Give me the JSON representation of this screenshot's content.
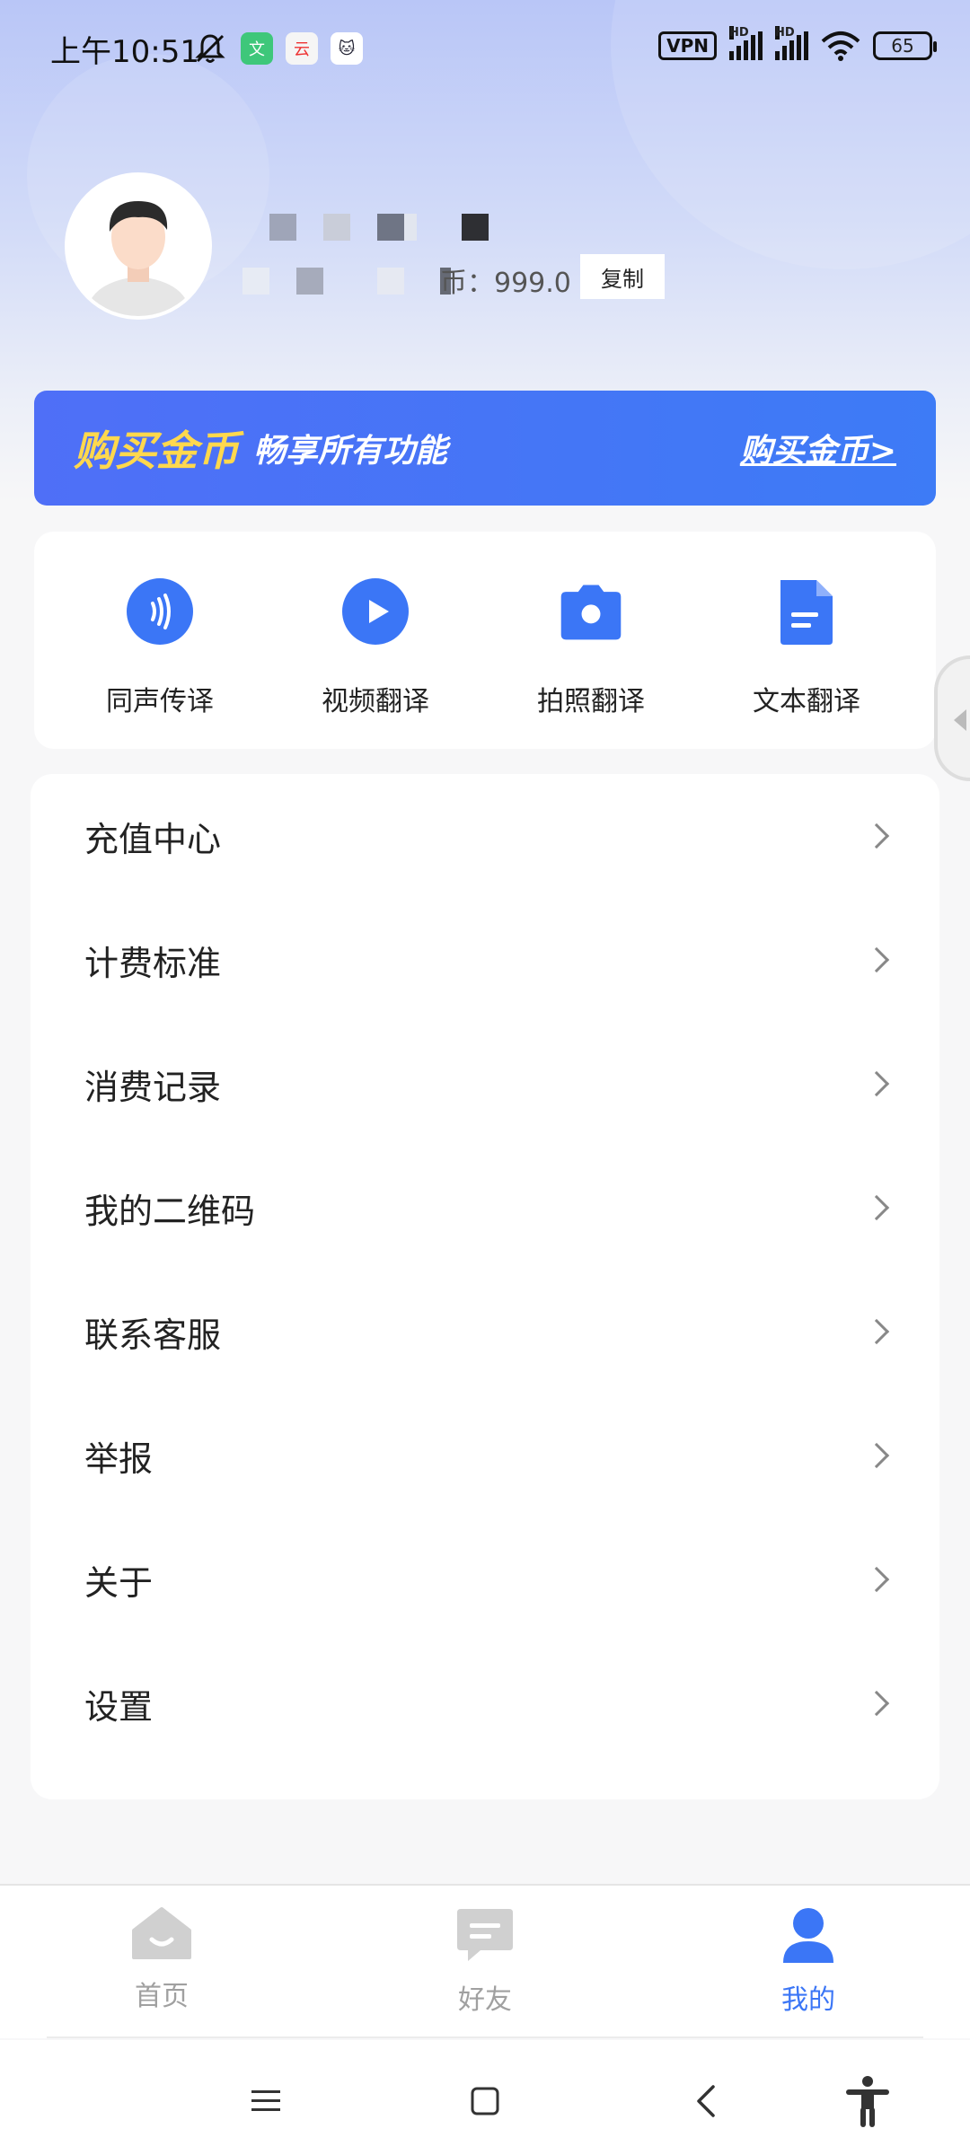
{
  "status_bar": {
    "time": "上午10:51",
    "vpn": "VPN",
    "hd1": "HD",
    "hd2": "HD",
    "battery": "65"
  },
  "profile": {
    "coin_text": "币：999.0",
    "copy_label": "复制"
  },
  "banner": {
    "title": "购买金币",
    "subtitle": "畅享所有功能",
    "link": "购买金币>"
  },
  "features": [
    {
      "label": "同声传译",
      "icon": "sound-wave-icon"
    },
    {
      "label": "视频翻译",
      "icon": "play-icon"
    },
    {
      "label": "拍照翻译",
      "icon": "camera-icon"
    },
    {
      "label": "文本翻译",
      "icon": "document-icon"
    }
  ],
  "menu": [
    {
      "label": "充值中心"
    },
    {
      "label": "计费标准"
    },
    {
      "label": "消费记录"
    },
    {
      "label": "我的二维码"
    },
    {
      "label": "联系客服"
    },
    {
      "label": "举报"
    },
    {
      "label": "关于"
    },
    {
      "label": "设置"
    }
  ],
  "tabs": [
    {
      "label": "首页",
      "icon": "home-icon",
      "active": false
    },
    {
      "label": "好友",
      "icon": "chat-icon",
      "active": false
    },
    {
      "label": "我的",
      "icon": "user-icon",
      "active": true
    }
  ],
  "colors": {
    "accent": "#3b76f6",
    "banner_gold": "#ffd84d",
    "inactive": "#a0a0a0"
  }
}
